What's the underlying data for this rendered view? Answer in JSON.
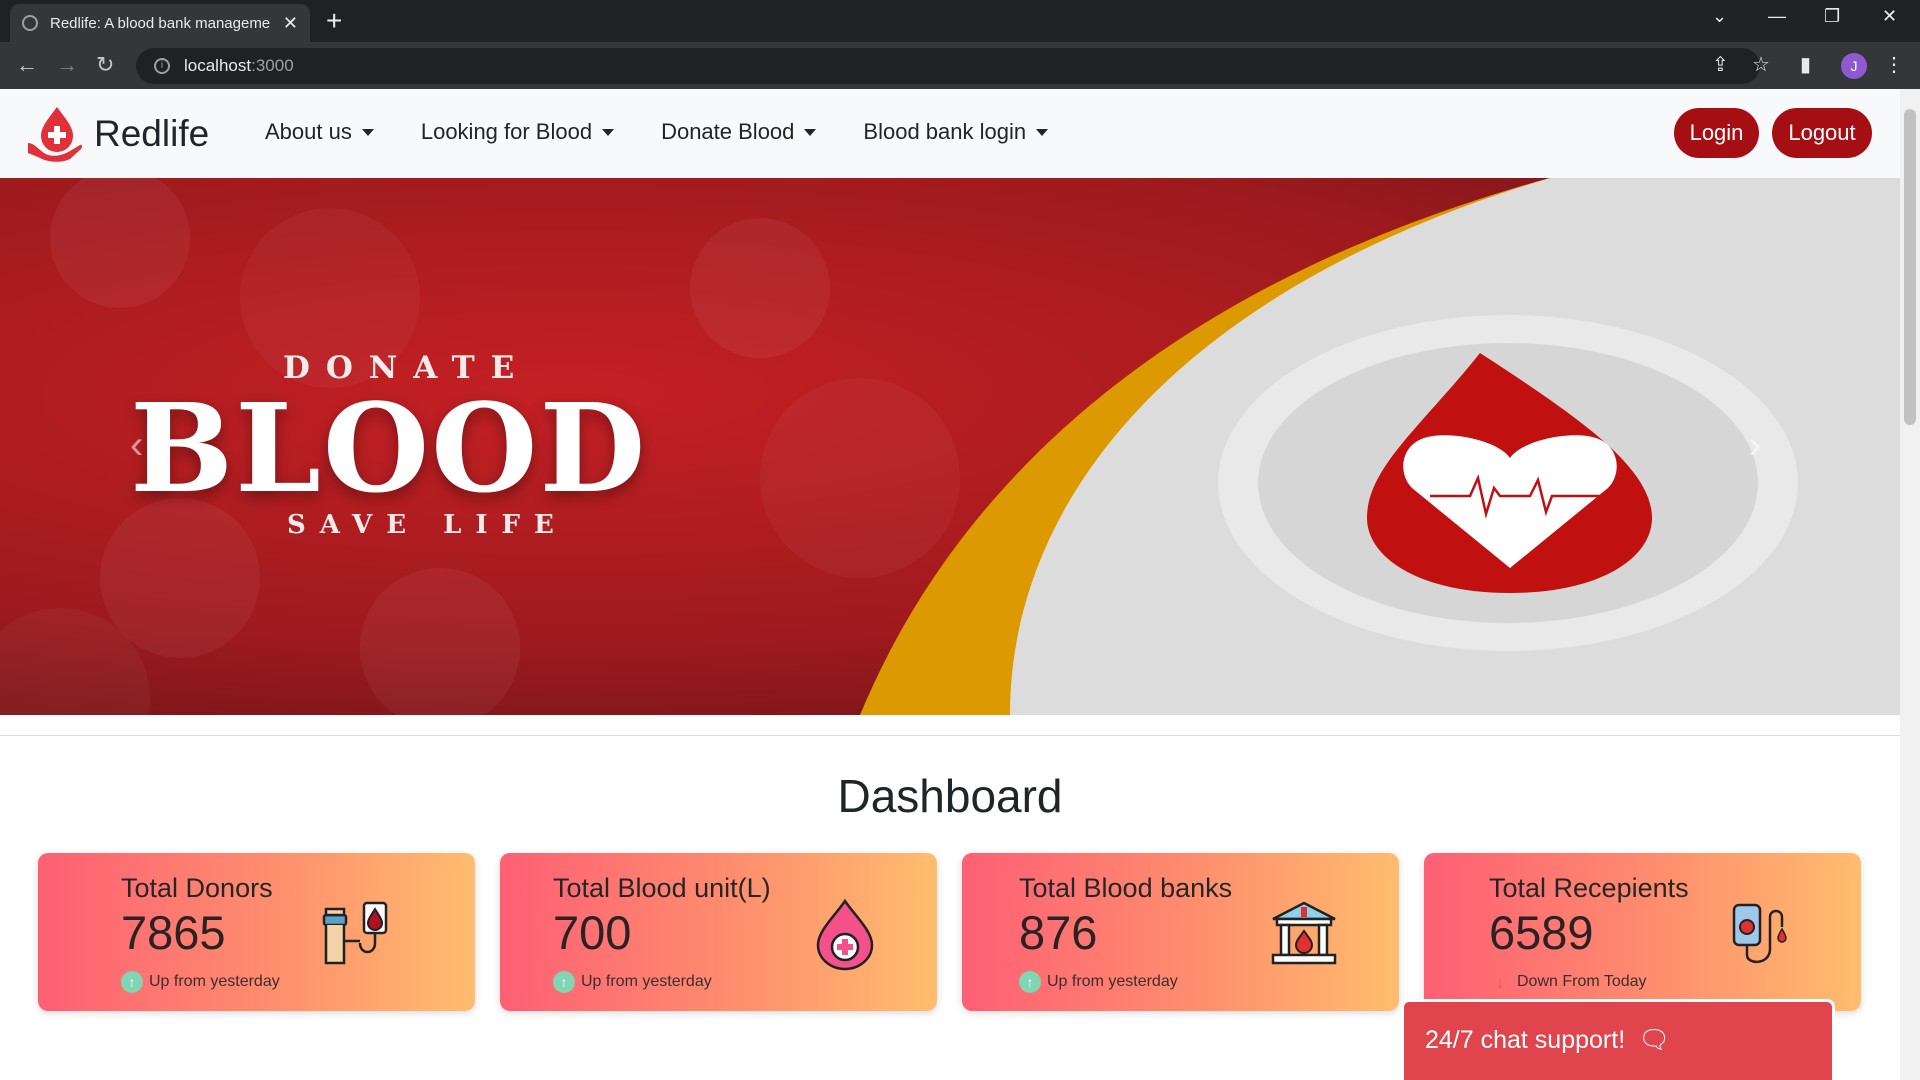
{
  "browser": {
    "tab_title": "Redlife: A blood bank manageme",
    "url_host": "localhost",
    "url_port": ":3000",
    "profile_initial": "J"
  },
  "navbar": {
    "brand": "Redlife",
    "links": [
      {
        "label": "About us"
      },
      {
        "label": "Looking for Blood"
      },
      {
        "label": "Donate Blood"
      },
      {
        "label": "Blood bank login"
      }
    ],
    "login_label": "Login",
    "logout_label": "Logout"
  },
  "hero": {
    "line1": "DONATE",
    "line2": "BLOOD",
    "line3": "SAVE LIFE"
  },
  "dashboard": {
    "title": "Dashboard",
    "cards": [
      {
        "title": "Total Donors",
        "value": "7865",
        "trend": "Up from yesterday",
        "direction": "up",
        "icon": "blood-donation-icon"
      },
      {
        "title": "Total Blood unit(L)",
        "value": "700",
        "trend": "Up from yesterday",
        "direction": "up",
        "icon": "blood-drop-plus-icon"
      },
      {
        "title": "Total Blood banks",
        "value": "876",
        "trend": "Up from yesterday",
        "direction": "up",
        "icon": "blood-bank-building-icon"
      },
      {
        "title": "Total Recepients",
        "value": "6589",
        "trend": "Down From Today",
        "direction": "down",
        "icon": "iv-blood-bag-icon"
      }
    ]
  },
  "chat": {
    "label": "24/7 chat support!"
  },
  "colors": {
    "brand_red": "#a50f14",
    "card_gradient_start": "#fe5f74",
    "card_gradient_end": "#ffbd6e",
    "chat_bg": "#e0444c"
  }
}
